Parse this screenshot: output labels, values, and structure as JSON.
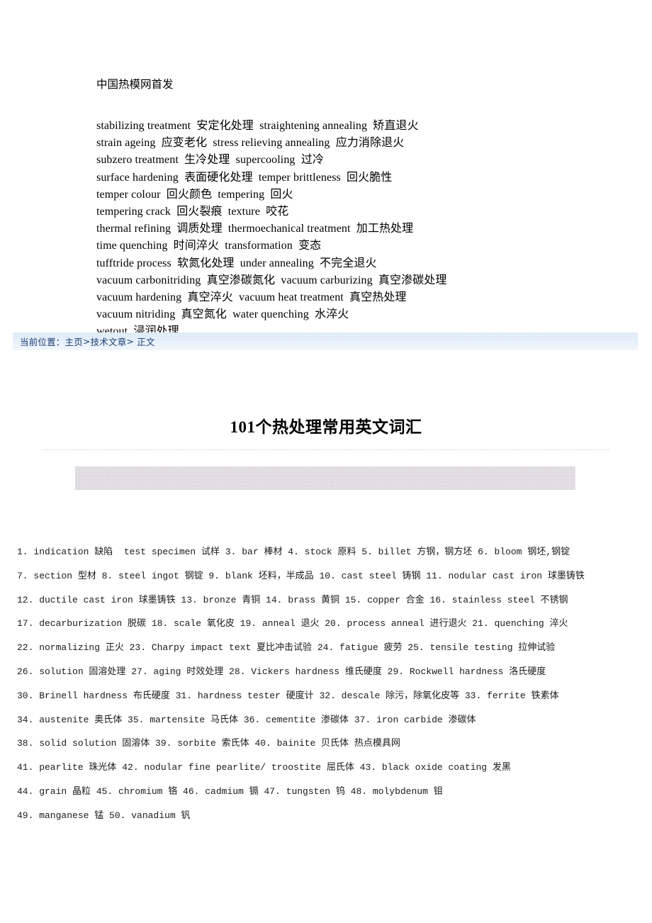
{
  "glossary": {
    "source_note": "中国热模网首发",
    "lines": [
      "stabilizing treatment  安定化处理  straightening annealing  矫直退火",
      "strain ageing  应变老化  stress relieving annealing  应力消除退火",
      "subzero treatment  生冷处理  supercooling  过冷",
      "surface hardening  表面硬化处理  temper brittleness  回火脆性",
      "temper colour  回火颜色  tempering  回火",
      "tempering crack  回火裂痕  texture  咬花",
      "thermal refining  调质处理  thermoechanical treatment  加工热处理",
      "time quenching  时间淬火  transformation  变态",
      "tufftride process  软氮化处理  under annealing  不完全退火",
      "vacuum carbonitriding  真空渗碳氮化  vacuum carburizing  真空渗碳处理",
      "vacuum hardening  真空淬火  vacuum heat treatment  真空热处理",
      "vacuum nitriding  真空氮化  water quenching  水淬火",
      "wetout  浸润处理"
    ]
  },
  "breadcrumb": {
    "prefix": "当前位置：",
    "home": "主页",
    "separator_1": ">",
    "category": "技术文章",
    "separator_2": ">",
    "current": " 正文"
  },
  "article": {
    "title": "101个热处理常用英文词汇",
    "body_lines": [
      "1. indication 缺陷  test specimen 试样 3. bar 棒材 4. stock 原料 5. billet 方钢，钢方坯 6. bloom 钢坯,钢锭",
      "7. section 型材 8. steel ingot 钢锭 9. blank 坯料，半成品 10. cast steel 铸钢 11. nodular cast iron 球墨铸铁",
      "12. ductile cast iron 球墨铸铁 13. bronze 青铜 14. brass 黄铜 15. copper 合金 16. stainless steel 不锈钢",
      "17. decarburization 脱碳 18. scale 氧化皮 19. anneal 退火 20. process anneal 进行退火 21. quenching 淬火",
      "22. normalizing 正火 23. Charpy impact text 夏比冲击试验 24. fatigue 疲劳 25. tensile testing 拉伸试验",
      "26. solution 固溶处理 27. aging 时效处理 28. Vickers hardness 维氏硬度 29. Rockwell hardness 洛氏硬度",
      "30. Brinell hardness 布氏硬度 31. hardness tester 硬度计 32. descale 除污，除氧化皮等 33. ferrite 铁素体",
      "34. austenite 奥氏体 35. martensite 马氏体 36. cementite 渗碳体 37. iron carbide 渗碳体",
      "38. solid solution 固溶体 39. sorbite 索氏体 40. bainite 贝氏体 热点模具网",
      "41. pearlite 珠光体 42. nodular fine pearlite/ troostite 屈氏体 43. black oxide coating 发黑",
      "44. grain 晶粒 45. chromium 铬 46. cadmium 镉 47. tungsten 钨 48. molybdenum 钼",
      "49. manganese 锰 50. vanadium 钒"
    ]
  },
  "colors": {
    "breadcrumb_bg": "#cfe0f5",
    "breadcrumb_text": "#1a3e73",
    "placeholder_bg": "#f3f2f4",
    "divider": "#b9b9bd",
    "body_text": "#1a1a1a"
  }
}
